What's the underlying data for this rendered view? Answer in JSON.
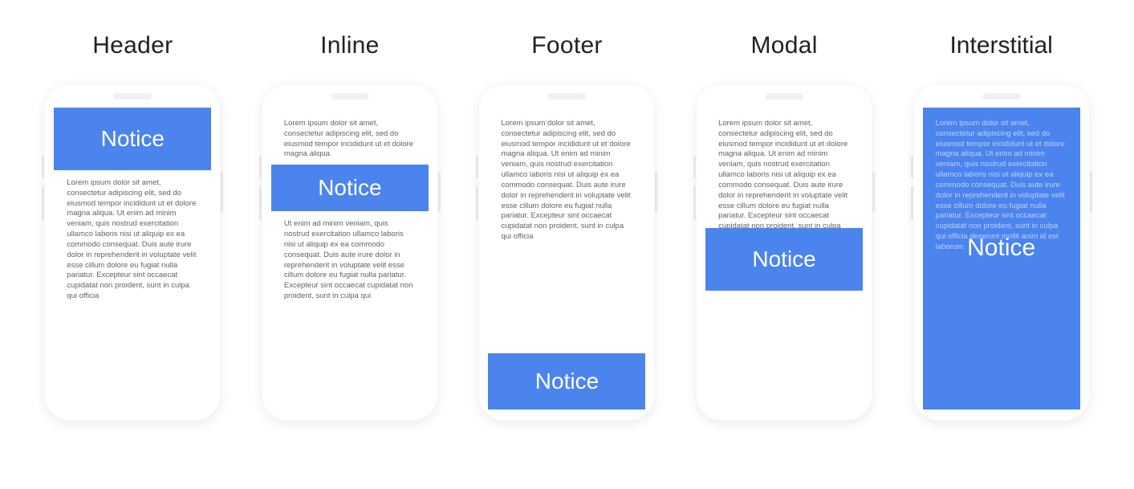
{
  "notice_label": "Notice",
  "lorem_short": "Lorem ipsum dolor sit amet, consectetur adipiscing elit, sed do eiusmod tempor incididunt ut et dolore magna aliqua.",
  "lorem_mid": "Ut enim ad minim veniam, quis nostrud exercitation ullamco laboris nisi ut aliquip ex ea commodo consequat. Duis aute irure dolor in reprehenderit in voluptate velit esse cillum dolore eu fugiat nulla pariatur. Excepteur sint occaecat cupidatat non proident, sunt in culpa qui",
  "lorem_long": "Lorem ipsum dolor sit amet, consectetur adipiscing elit, sed do eiusmod tempor incididunt ut et dolore magna aliqua. Ut enim ad minim veniam, quis nostrud exercitation ullamco laboris nisi ut aliquip ex ea commodo consequat. Duis aute irure dolor in reprehenderit in voluptate velit esse cillum dolore eu fugiat nulla pariatur. Excepteur sint occaecat cupidatat non proident, sunt in culpa qui officia",
  "lorem_modal": "Lorem ipsum dolor sit amet, consectetur adipiscing elit, sed do eiusmod tempor incididunt ut et dolore magna aliqua. Ut enim ad minim veniam, quis nostrud exercitation ullamco laboris nisi ut aliquip ex ea commodo consequat. Duis aute irure dolor in reprehenderit in voluptate velit esse cillum dolore eu fugiat nulla pariatur. Excepteur sint occaecat cupidatat non proident, sunt in culpa qui officia deserunt mollit anim id est laborum.",
  "lorem_inter": "Lorem ipsum dolor sit amet, consectetur adipiscing elit, sed do eiusmod tempor incididunt ut et dolore magna aliqua. Ut enim ad minim veniam, quis nostrud exercitation ullamco laboris nisi ut aliquip ex ea commodo consequat. Duis aute irure dolor in reprehenderit in voluptate velit esse cillum dolore eu fugiat nulla pariatur. Excepteur sint occaecat cupidatat non proident, sunt in culpa qui officia deserunt mollit anim id est laborum.",
  "columns": {
    "0": {
      "title": "Header"
    },
    "1": {
      "title": "Inline"
    },
    "2": {
      "title": "Footer"
    },
    "3": {
      "title": "Modal"
    },
    "4": {
      "title": "Interstitial"
    }
  },
  "accent": "#4c84ee"
}
